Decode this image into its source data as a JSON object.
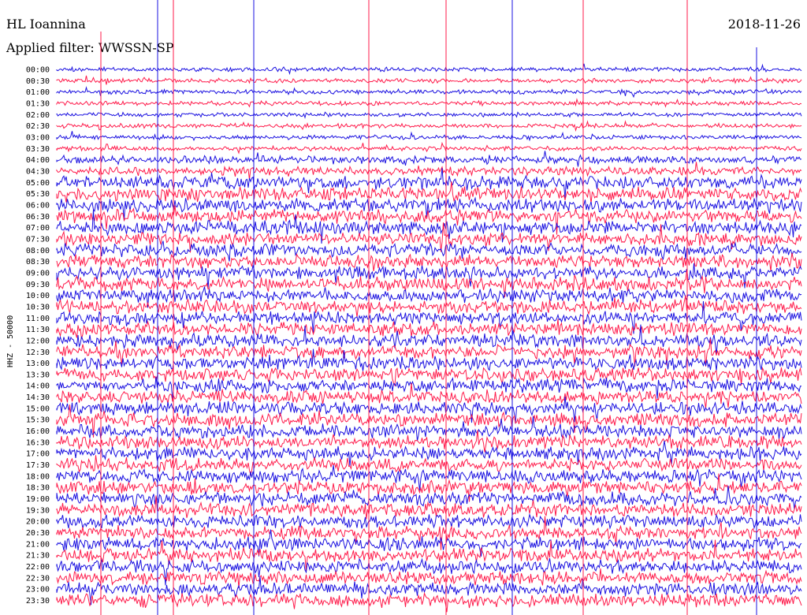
{
  "header": {
    "station": "HL Ioannina",
    "filter_text": "Applied filter: WWSSN-SP",
    "date": "2018-11-26"
  },
  "channel_label": "HHZ - 50000",
  "trace_colors": [
    "#1a10e0",
    "#ff1a4a"
  ],
  "time_labels": [
    "00:00",
    "00:30",
    "01:00",
    "01:30",
    "02:00",
    "02:30",
    "03:00",
    "03:30",
    "04:00",
    "04:30",
    "05:00",
    "05:30",
    "06:00",
    "06:30",
    "07:00",
    "07:30",
    "08:00",
    "08:30",
    "09:00",
    "09:30",
    "10:00",
    "10:30",
    "11:00",
    "11:30",
    "12:00",
    "12:30",
    "13:00",
    "13:30",
    "14:00",
    "14:30",
    "15:00",
    "15:30",
    "16:00",
    "16:30",
    "17:00",
    "17:30",
    "18:00",
    "18:30",
    "19:00",
    "19:30",
    "20:00",
    "20:30",
    "21:00",
    "21:30",
    "22:00",
    "22:30",
    "23:00",
    "23:30"
  ]
}
